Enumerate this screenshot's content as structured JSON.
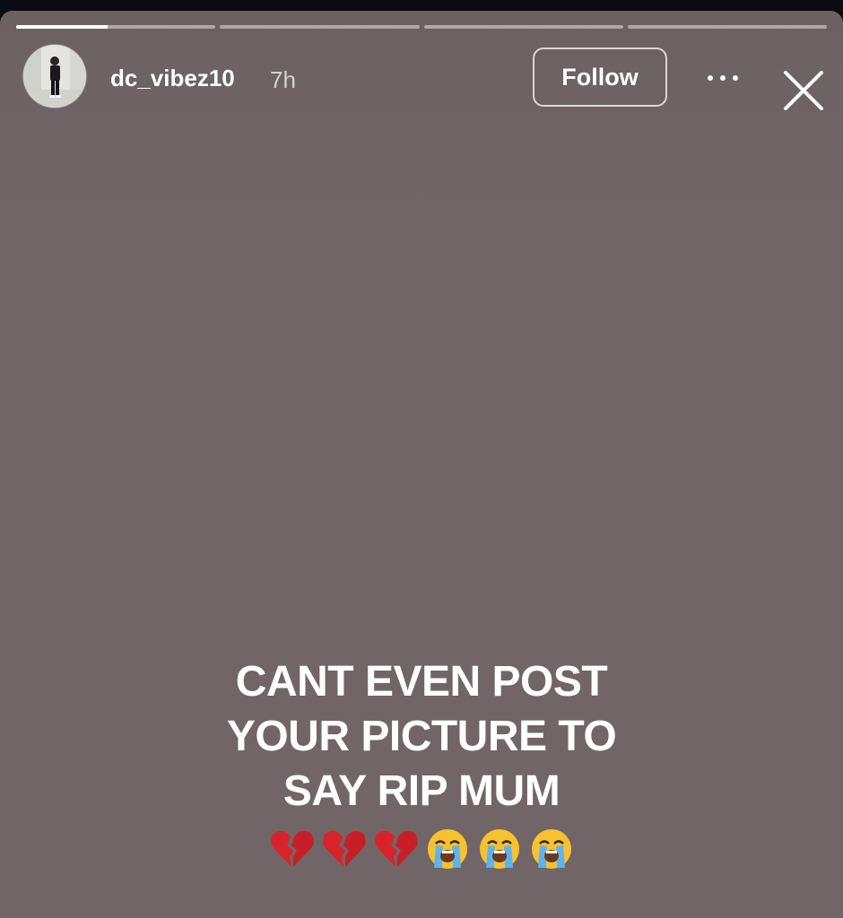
{
  "story": {
    "progress": [
      0.46,
      0,
      0,
      0
    ],
    "background_color": "#716567"
  },
  "header": {
    "avatar_icon": "profile-photo-avatar",
    "username": "dc_vibez10",
    "time": "7h",
    "follow_label": "Follow",
    "more_icon": "more-horizontal-icon",
    "close_icon": "close-icon"
  },
  "caption": {
    "lines": [
      "CANT EVEN POST",
      "YOUR PICTURE TO",
      "SAY RIP MUM"
    ],
    "emojis": [
      "💔",
      "💔",
      "💔",
      "😭",
      "😭",
      "😭"
    ]
  }
}
